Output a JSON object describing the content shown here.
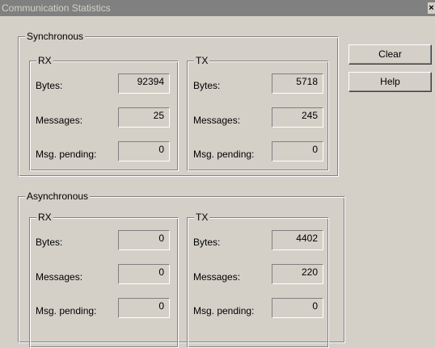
{
  "window": {
    "title": "Communication Statistics",
    "close_glyph": "×"
  },
  "buttons": {
    "clear": "Clear",
    "help": "Help"
  },
  "sync": {
    "title": "Synchronous",
    "rx": {
      "title": "RX",
      "bytes_label": "Bytes:",
      "bytes": "92394",
      "messages_label": "Messages:",
      "messages": "25",
      "pending_label": "Msg. pending:",
      "pending": "0"
    },
    "tx": {
      "title": "TX",
      "bytes_label": "Bytes:",
      "bytes": "5718",
      "messages_label": "Messages:",
      "messages": "245",
      "pending_label": "Msg. pending:",
      "pending": "0"
    }
  },
  "async": {
    "title": "Asynchronous",
    "rx": {
      "title": "RX",
      "bytes_label": "Bytes:",
      "bytes": "0",
      "messages_label": "Messages:",
      "messages": "0",
      "pending_label": "Msg. pending:",
      "pending": "0"
    },
    "tx": {
      "title": "TX",
      "bytes_label": "Bytes:",
      "bytes": "4402",
      "messages_label": "Messages:",
      "messages": "220",
      "pending_label": "Msg. pending:",
      "pending": "0"
    }
  }
}
